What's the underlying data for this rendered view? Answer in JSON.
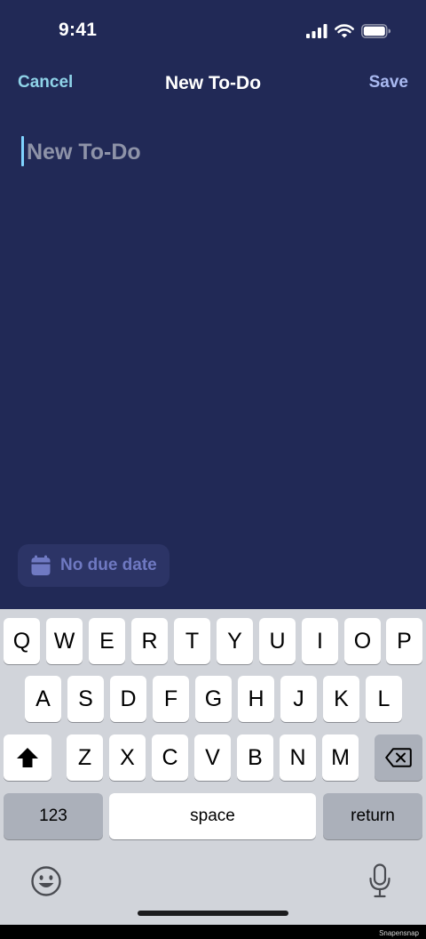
{
  "status_bar": {
    "time": "9:41",
    "signal_icon": "cellular-signal-icon",
    "wifi_icon": "wifi-icon",
    "battery_icon": "battery-icon"
  },
  "nav": {
    "cancel_label": "Cancel",
    "title": "New To-Do",
    "save_label": "Save"
  },
  "todo": {
    "title_value": "",
    "title_placeholder": "New To-Do"
  },
  "due_date": {
    "icon": "calendar-icon",
    "label": "No due date"
  },
  "keyboard": {
    "row1": [
      "Q",
      "W",
      "E",
      "R",
      "T",
      "Y",
      "U",
      "I",
      "O",
      "P"
    ],
    "row2": [
      "A",
      "S",
      "D",
      "F",
      "G",
      "H",
      "J",
      "K",
      "L"
    ],
    "row3": [
      "Z",
      "X",
      "C",
      "V",
      "B",
      "N",
      "M"
    ],
    "shift_icon": "shift-icon",
    "backspace_icon": "backspace-icon",
    "numbers_label": "123",
    "space_label": "space",
    "return_label": "return",
    "emoji_icon": "emoji-icon",
    "mic_icon": "microphone-icon"
  },
  "colors": {
    "background": "#212956",
    "cancel": "#8fd3e8",
    "save": "#a9b9f0",
    "keyboard": "#d1d4da",
    "due_date_text": "#6f79c2"
  },
  "watermark": "Snapensnap"
}
